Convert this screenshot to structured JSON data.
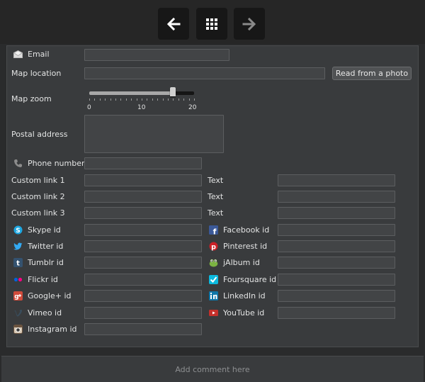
{
  "toolbar": {
    "back_icon": "arrow-left-icon",
    "grid_icon": "grid-icon",
    "forward_icon": "arrow-right-icon"
  },
  "form": {
    "email": {
      "label": "Email",
      "icon": "envelope-icon",
      "value": ""
    },
    "map_location": {
      "label": "Map location",
      "value": "",
      "button": "Read from a photo"
    },
    "map_zoom": {
      "label": "Map zoom",
      "min": 0,
      "max": 20,
      "value": 16,
      "ticks": [
        "0",
        "10",
        "20"
      ]
    },
    "postal_address": {
      "label": "Postal address",
      "value": ""
    },
    "phone": {
      "label": "Phone number",
      "icon": "phone-icon",
      "value": ""
    },
    "custom_links": [
      {
        "label": "Custom link 1",
        "text_label": "Text",
        "value": "",
        "text_value": ""
      },
      {
        "label": "Custom link 2",
        "text_label": "Text",
        "value": "",
        "text_value": ""
      },
      {
        "label": "Custom link 3",
        "text_label": "Text",
        "value": "",
        "text_value": ""
      }
    ],
    "social_left": [
      {
        "label": "Skype id",
        "icon": "skype-icon",
        "value": ""
      },
      {
        "label": "Twitter id",
        "icon": "twitter-icon",
        "value": ""
      },
      {
        "label": "Tumblr id",
        "icon": "tumblr-icon",
        "value": ""
      },
      {
        "label": "Flickr id",
        "icon": "flickr-icon",
        "value": ""
      },
      {
        "label": "Google+ id",
        "icon": "google-plus-icon",
        "value": ""
      },
      {
        "label": "Vimeo id",
        "icon": "vimeo-icon",
        "value": ""
      },
      {
        "label": "Instagram id",
        "icon": "instagram-icon",
        "value": ""
      }
    ],
    "social_right": [
      {
        "label": "Facebook id",
        "icon": "facebook-icon",
        "value": ""
      },
      {
        "label": "Pinterest id",
        "icon": "pinterest-icon",
        "value": ""
      },
      {
        "label": "jAlbum id",
        "icon": "jalbum-icon",
        "value": ""
      },
      {
        "label": "Foursquare id",
        "icon": "foursquare-icon",
        "value": ""
      },
      {
        "label": "LinkedIn id",
        "icon": "linkedin-icon",
        "value": ""
      },
      {
        "label": "YouTube id",
        "icon": "youtube-icon",
        "value": ""
      }
    ]
  },
  "comment": {
    "placeholder": "Add comment here"
  },
  "colors": {
    "background": "#2a2b2c",
    "panel": "#393b3d",
    "field": "#424446",
    "text": "#e3e4e4",
    "nav_button": "#171717"
  }
}
